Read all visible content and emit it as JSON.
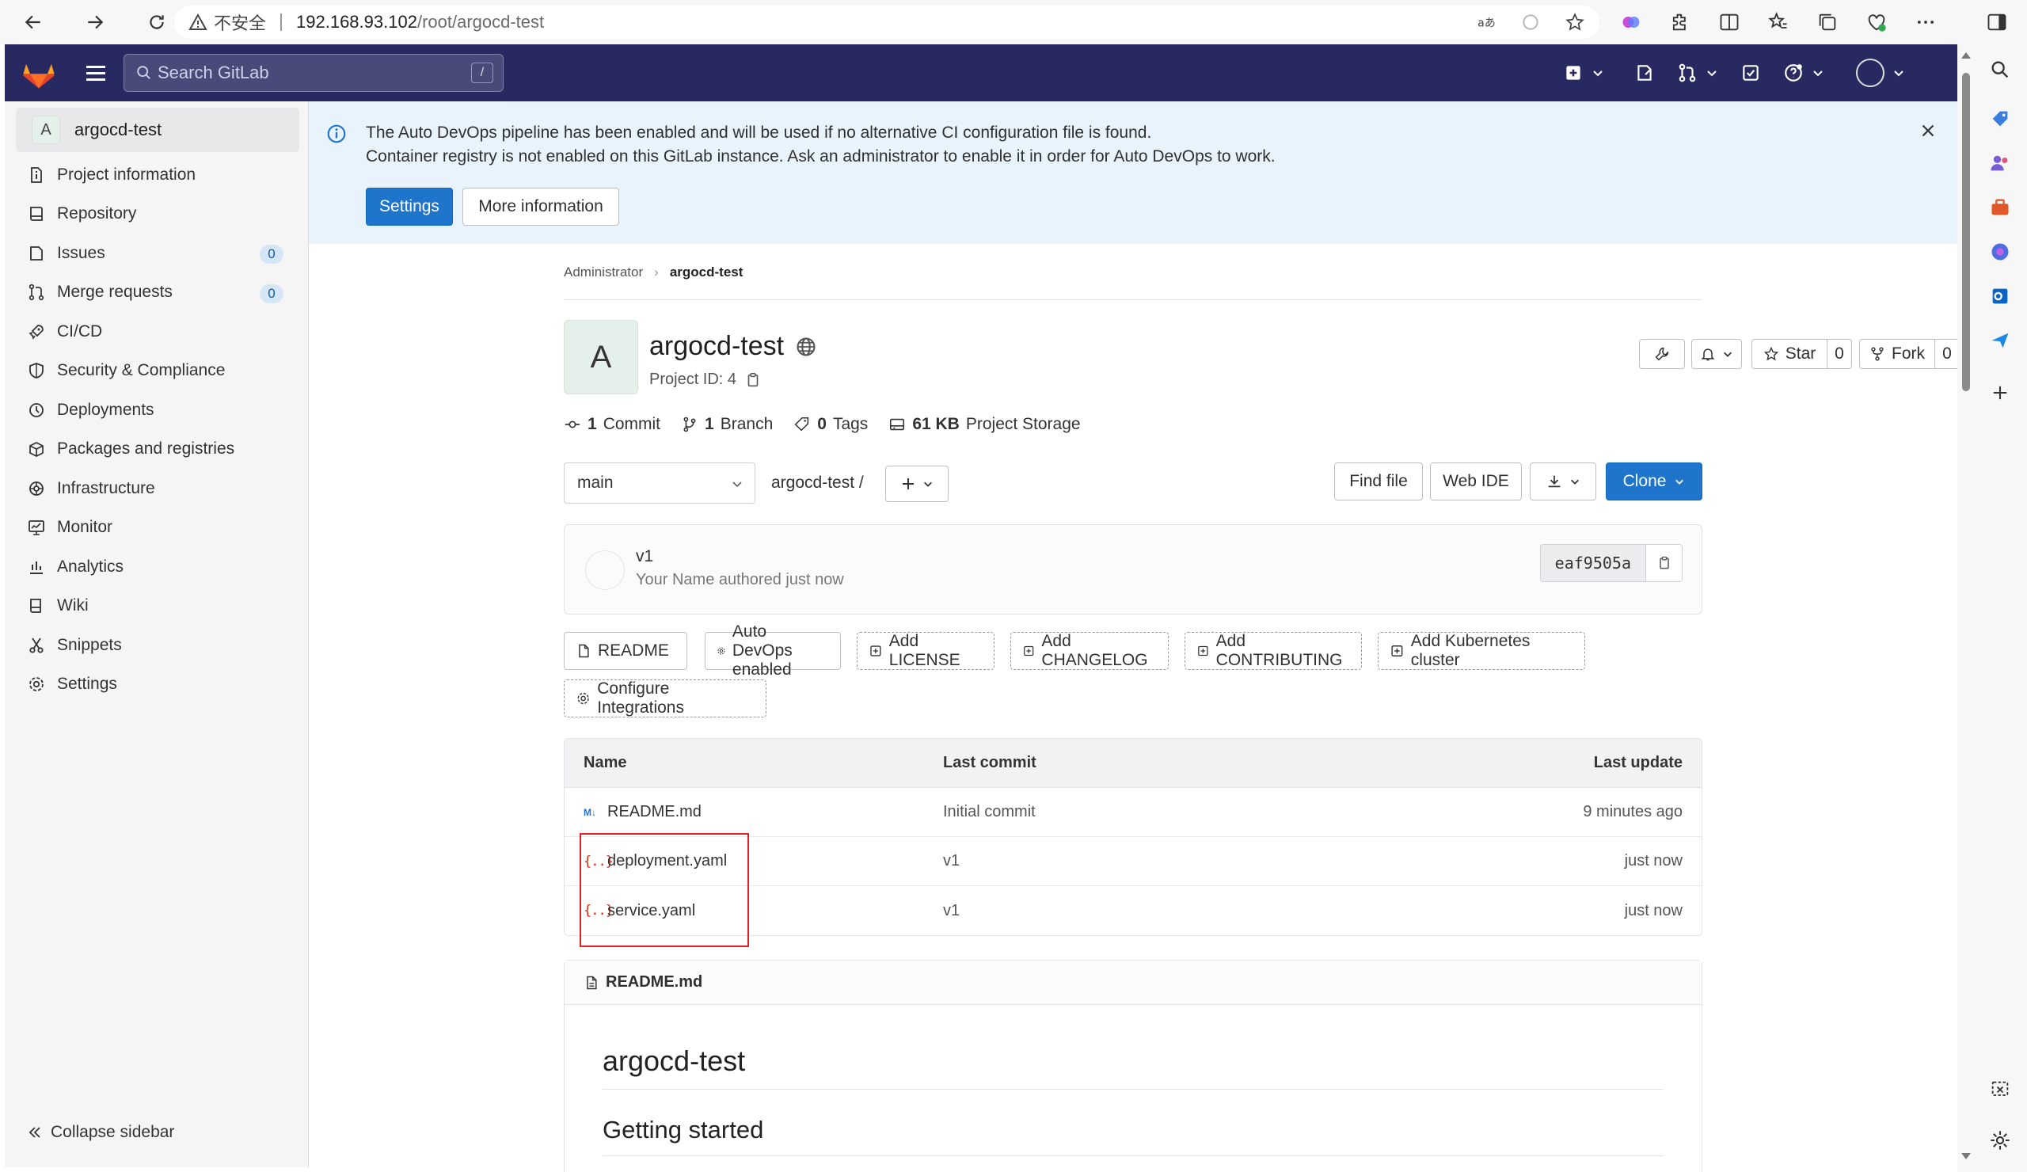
{
  "browser": {
    "security_label": "不安全",
    "url_host": "192.168.93.102",
    "url_path": "/root/argocd-test"
  },
  "topbar": {
    "search_placeholder": "Search GitLab",
    "search_shortcut": "/"
  },
  "sidebar": {
    "project_avatar": "A",
    "project_name": "argocd-test",
    "items": [
      {
        "label": "Project information",
        "icon": "info-icon"
      },
      {
        "label": "Repository",
        "icon": "repository-icon"
      },
      {
        "label": "Issues",
        "icon": "issues-icon",
        "badge": "0"
      },
      {
        "label": "Merge requests",
        "icon": "merge-request-icon",
        "badge": "0"
      },
      {
        "label": "CI/CD",
        "icon": "rocket-icon"
      },
      {
        "label": "Security & Compliance",
        "icon": "shield-icon"
      },
      {
        "label": "Deployments",
        "icon": "deployments-icon"
      },
      {
        "label": "Packages and registries",
        "icon": "package-icon"
      },
      {
        "label": "Infrastructure",
        "icon": "cloud-icon"
      },
      {
        "label": "Monitor",
        "icon": "monitor-icon"
      },
      {
        "label": "Analytics",
        "icon": "chart-icon"
      },
      {
        "label": "Wiki",
        "icon": "book-icon"
      },
      {
        "label": "Snippets",
        "icon": "scissors-icon"
      },
      {
        "label": "Settings",
        "icon": "gear-icon"
      }
    ],
    "collapse_label": "Collapse sidebar"
  },
  "banner": {
    "line1": "The Auto DevOps pipeline has been enabled and will be used if no alternative CI configuration file is found.",
    "line2": "Container registry is not enabled on this GitLab instance. Ask an administrator to enable it in order for Auto DevOps to work.",
    "settings_label": "Settings",
    "more_info_label": "More information"
  },
  "breadcrumb": {
    "parent": "Administrator",
    "separator": "›",
    "current": "argocd-test"
  },
  "project": {
    "avatar": "A",
    "title": "argocd-test",
    "id_label": "Project ID: 4",
    "star_label": "Star",
    "star_count": "0",
    "fork_label": "Fork",
    "fork_count": "0"
  },
  "stats": {
    "commits_num": "1",
    "commits_label": "Commit",
    "branches_num": "1",
    "branches_label": "Branch",
    "tags_num": "0",
    "tags_label": "Tags",
    "storage_num": "61 KB",
    "storage_label": "Project Storage"
  },
  "toolbar": {
    "branch": "main",
    "repo_path": "argocd-test  /",
    "find_file": "Find file",
    "web_ide": "Web IDE",
    "clone": "Clone"
  },
  "last_commit": {
    "title": "v1",
    "meta": "Your Name authored just now",
    "sha": "eaf9505a"
  },
  "quick_actions": [
    {
      "label": "README",
      "icon": "file-icon",
      "style": "solid"
    },
    {
      "label": "Auto DevOps enabled",
      "icon": "gear-icon",
      "style": "solid"
    },
    {
      "label": "Add LICENSE",
      "icon": "plus-square-icon",
      "style": "dashed"
    },
    {
      "label": "Add CHANGELOG",
      "icon": "plus-square-icon",
      "style": "dashed"
    },
    {
      "label": "Add CONTRIBUTING",
      "icon": "plus-square-icon",
      "style": "dashed"
    },
    {
      "label": "Add Kubernetes cluster",
      "icon": "plus-square-icon",
      "style": "dashed"
    },
    {
      "label": "Configure Integrations",
      "icon": "gear-icon",
      "style": "dashed"
    }
  ],
  "file_table": {
    "headers": {
      "name": "Name",
      "commit": "Last commit",
      "update": "Last update"
    },
    "rows": [
      {
        "name": "README.md",
        "type": "markdown",
        "commit": "Initial commit",
        "update": "9 minutes ago"
      },
      {
        "name": "deployment.yaml",
        "type": "yaml",
        "commit": "v1",
        "update": "just now"
      },
      {
        "name": "service.yaml",
        "type": "yaml",
        "commit": "v1",
        "update": "just now"
      }
    ]
  },
  "readme": {
    "filename": "README.md",
    "h1": "argocd-test",
    "h2": "Getting started"
  },
  "colors": {
    "navbar": "#292961",
    "primary": "#1f75cb",
    "banner_bg": "#e8f3fc",
    "highlight": "#e02020"
  }
}
